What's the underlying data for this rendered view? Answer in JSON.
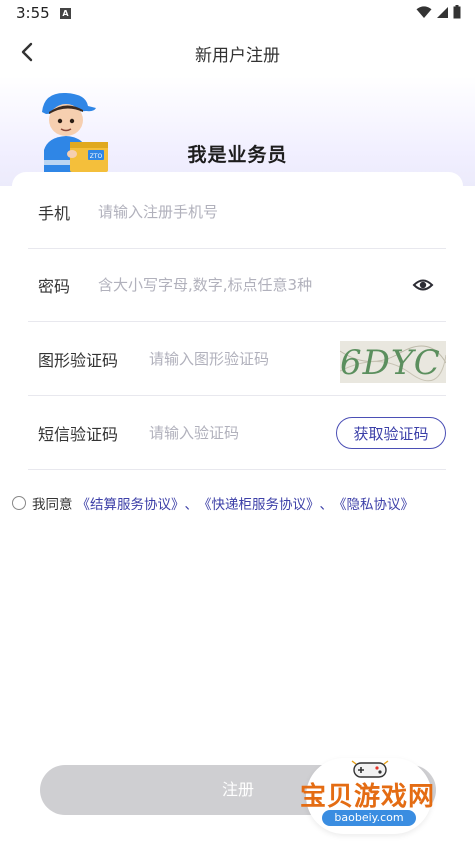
{
  "status_bar": {
    "time": "3:55",
    "notification_badge": "A"
  },
  "nav": {
    "title": "新用户注册"
  },
  "hero": {
    "role_title": "我是业务员",
    "box_logo": "ZTO"
  },
  "form": {
    "phone": {
      "label": "手机",
      "placeholder": "请输入注册手机号"
    },
    "password": {
      "label": "密码",
      "placeholder": "含大小写字母,数字,标点任意3种"
    },
    "captcha": {
      "label": "图形验证码",
      "placeholder": "请输入图形验证码",
      "image_text": "6DYC"
    },
    "sms": {
      "label": "短信验证码",
      "placeholder": "请输入验证码",
      "button_label": "获取验证码"
    }
  },
  "agreement": {
    "prefix": "我同意",
    "links": [
      "《结算服务协议》",
      "《快递柜服务协议》",
      "《隐私协议》"
    ],
    "separator": "、"
  },
  "register": {
    "label": "注册"
  },
  "watermark": {
    "title": "宝贝游戏网",
    "url": "baobeiy.com"
  },
  "colors": {
    "accent": "#3d40a8",
    "button_disabled": "#cfcfd2",
    "hero_gradient_end": "#ecebfb",
    "watermark_orange": "#e46c13"
  }
}
